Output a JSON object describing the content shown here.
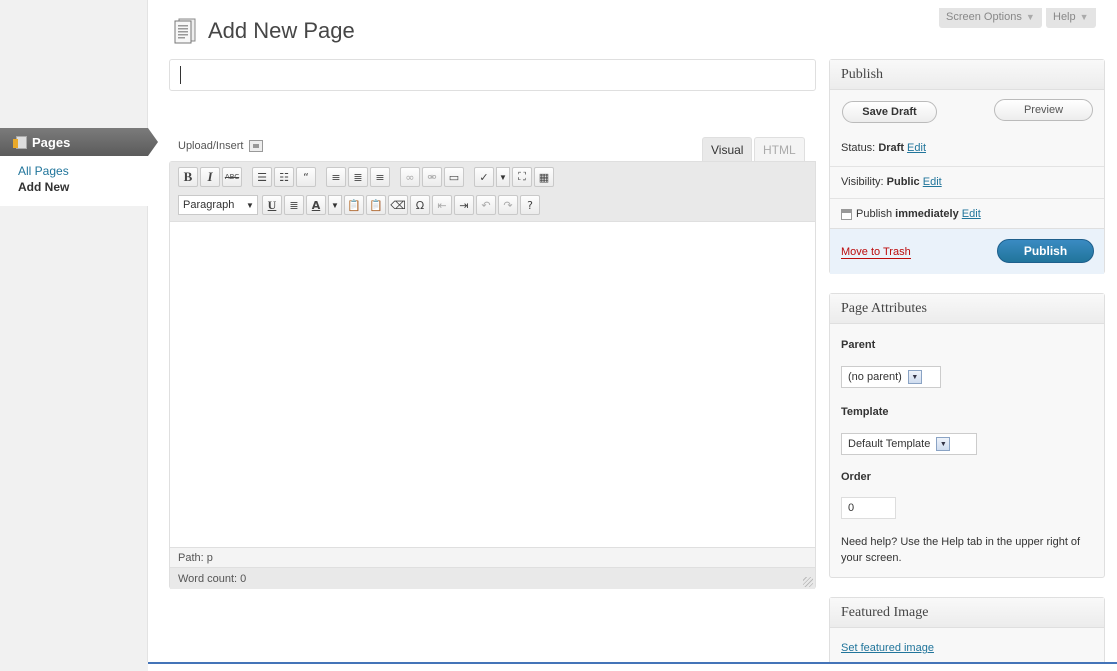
{
  "header": {
    "title": "Add New Page",
    "screen_options": "Screen Options",
    "help": "Help"
  },
  "sidebar": {
    "menu_title": "Pages",
    "items": [
      {
        "label": "All Pages"
      },
      {
        "label": "Add New"
      }
    ]
  },
  "editor": {
    "title_value": "",
    "upload_insert": "Upload/Insert",
    "tabs": [
      {
        "label": "Visual"
      },
      {
        "label": "HTML"
      }
    ],
    "format_select": "Paragraph",
    "path_label": "Path:",
    "path_value": "p",
    "word_count": "Word count: 0"
  },
  "publish": {
    "title": "Publish",
    "save_draft": "Save Draft",
    "preview": "Preview",
    "status_label": "Status:",
    "status_value": "Draft",
    "visibility_label": "Visibility:",
    "visibility_value": "Public",
    "publish_label": "Publish",
    "publish_value": "immediately",
    "edit": "Edit",
    "move_to_trash": "Move to Trash",
    "publish_button": "Publish"
  },
  "page_attributes": {
    "title": "Page Attributes",
    "parent_label": "Parent",
    "parent_value": "(no parent)",
    "template_label": "Template",
    "template_value": "Default Template",
    "order_label": "Order",
    "order_value": "0",
    "help_text": "Need help? Use the Help tab in the upper right of your screen."
  },
  "featured_image": {
    "title": "Featured Image",
    "link": "Set featured image"
  },
  "colors": {
    "link": "#21759b",
    "publish_button": "#21759b",
    "trash": "#bc0b0b",
    "menu_head": "#6d6d6d"
  }
}
